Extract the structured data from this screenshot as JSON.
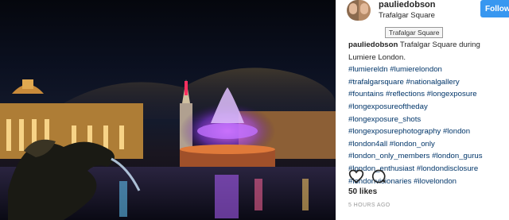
{
  "post": {
    "username": "pauliedobson",
    "location": "Trafalgar Square",
    "follow_label": "Follow",
    "tooltip": "Trafalgar Square",
    "caption_user": "pauliedobson",
    "caption_text": " Trafalgar Square during Lumiere London.",
    "hashtag_lines": [
      "#lumiereldn #lumierelondon",
      "#trafalgarsquare #nationalgallery",
      "#fountains #reflections #longexposure",
      "#longexposureoftheday",
      "#longexposure_shots",
      "#longexposurephotography #london",
      "#london4all #london_only",
      "#london_only_members #london_gurus",
      "#london_enthusiast #londondisclosure",
      "#londonvisionaries #ilovelondon"
    ],
    "likes": "50 likes",
    "time": "5 HOURS AGO"
  },
  "icons": {
    "like": "heart-icon",
    "comment": "comment-icon"
  },
  "colors": {
    "follow_button": "#3897f0",
    "hashtag": "#003569",
    "fountain_glow": "#b04fff"
  }
}
